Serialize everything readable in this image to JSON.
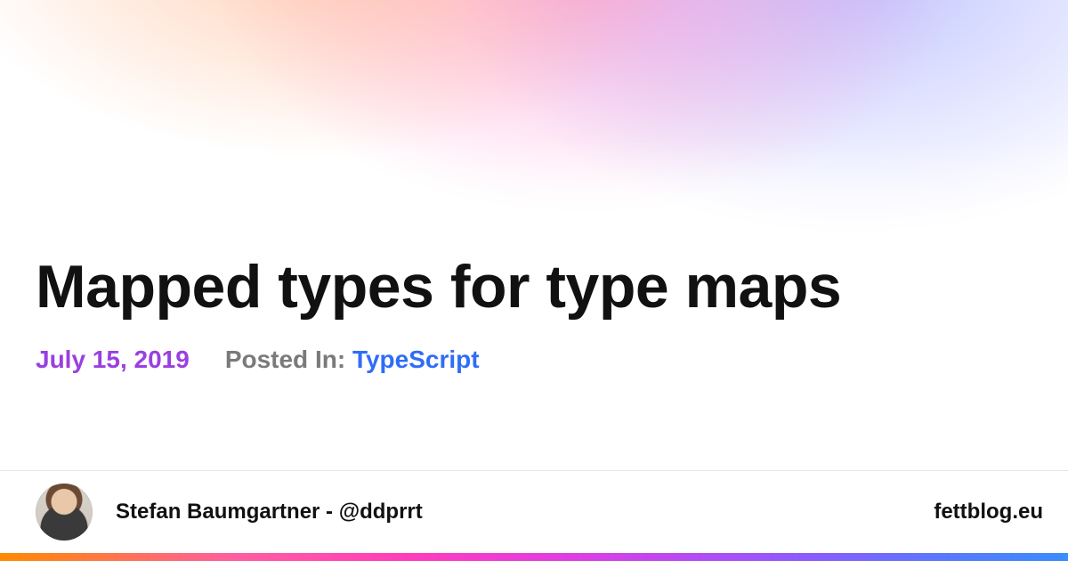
{
  "post": {
    "title": "Mapped types for type maps",
    "date": "July 15, 2019",
    "posted_in_label": "Posted In:",
    "tag": "TypeScript"
  },
  "footer": {
    "author": "Stefan Baumgartner - @ddprrt",
    "site": "fettblog.eu"
  }
}
